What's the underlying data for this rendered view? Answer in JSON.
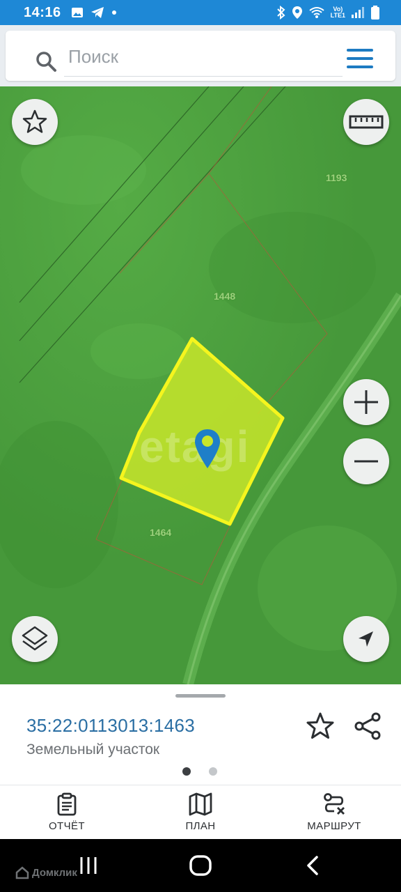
{
  "status_bar": {
    "time": "14:16",
    "lte_top": "Vo)",
    "lte_bottom": "LTE1",
    "icons": [
      "image-icon",
      "telegram-icon",
      "dot-icon",
      "bluetooth-icon",
      "location-icon",
      "wifi-icon",
      "signal-icon",
      "battery-icon"
    ]
  },
  "search": {
    "placeholder": "Поиск",
    "value": ""
  },
  "map": {
    "parcel_labels": [
      "1193",
      "1448",
      "1464"
    ],
    "watermark": "etagi",
    "colors": {
      "selected_parcel_fill": "#c8e62a",
      "selected_parcel_stroke": "#f5f51e",
      "marker": "#1e7fc8"
    },
    "buttons": [
      "favorite-star-icon",
      "ruler-icon",
      "zoom-in-icon",
      "zoom-out-icon",
      "layers-icon",
      "locate-arrow-icon"
    ]
  },
  "sheet": {
    "cadastral_number": "35:22:0113013:1463",
    "object_type": "Земельный участок",
    "page_indicator": {
      "total": 2,
      "active": 1
    }
  },
  "bottom_nav": {
    "items": [
      {
        "label": "ОТЧЁТ",
        "icon": "clipboard-icon"
      },
      {
        "label": "ПЛАН",
        "icon": "map-icon"
      },
      {
        "label": "МАРШРУТ",
        "icon": "route-icon"
      }
    ]
  },
  "system_nav": {
    "watermark": "Домклик"
  }
}
